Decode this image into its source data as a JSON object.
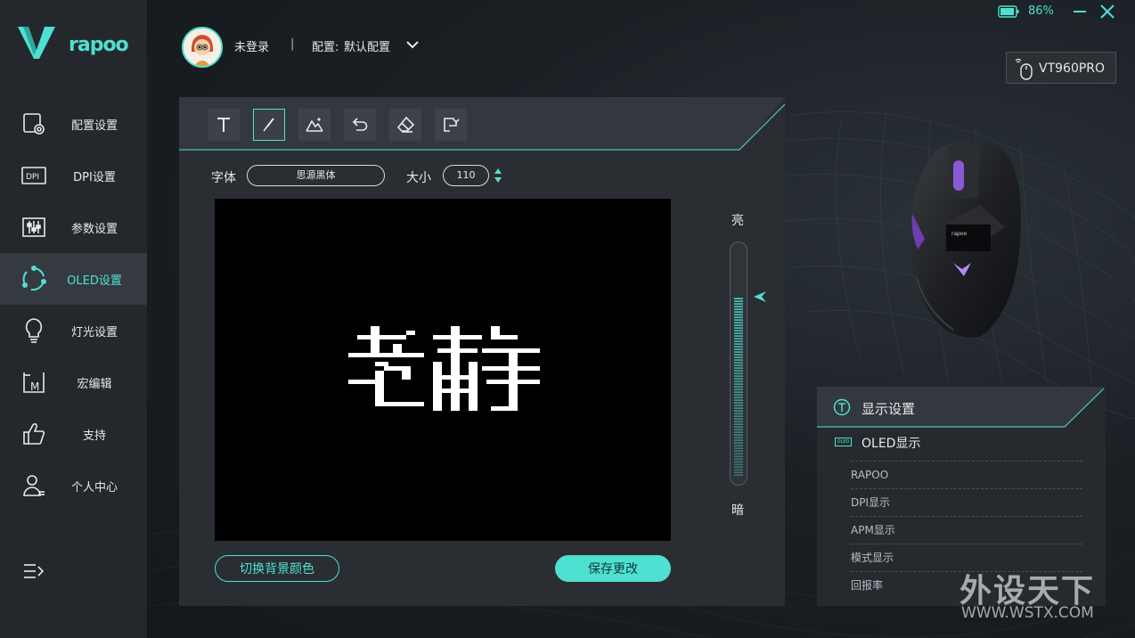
{
  "brand": {
    "logo_text": "rapoo"
  },
  "sidebar": {
    "items": [
      {
        "label": "配置设置",
        "icon": "config-icon"
      },
      {
        "label": "DPI设置",
        "icon": "dpi-icon"
      },
      {
        "label": "参数设置",
        "icon": "params-icon"
      },
      {
        "label": "OLED设置",
        "icon": "oled-icon",
        "active": true
      },
      {
        "label": "灯光设置",
        "icon": "lightbulb-icon"
      },
      {
        "label": "宏编辑",
        "icon": "macro-icon"
      },
      {
        "label": "支持",
        "icon": "thumbs-up-icon"
      },
      {
        "label": "个人中心",
        "icon": "user-icon"
      }
    ],
    "menu_icon": "menu-expand-icon"
  },
  "header": {
    "user_name": "未登录",
    "separator": "|",
    "config_label": "配置:",
    "config_value": "默认配置",
    "battery_pct": "86%",
    "device_name": "VT960PRO"
  },
  "editor": {
    "tools": [
      "text-tool-icon",
      "brush-tool-icon",
      "image-tool-icon",
      "undo-icon",
      "eraser-icon",
      "export-icon"
    ],
    "active_tool": "brush-tool-icon",
    "font_label": "字体",
    "font_value": "思源黑体",
    "size_label": "大小",
    "size_value": "110",
    "canvas_text": "老静",
    "brightness_high": "亮",
    "brightness_low": "暗",
    "brightness_level": 0.78,
    "bg_toggle_label": "切换背景颜色",
    "save_label": "保存更改"
  },
  "display_settings": {
    "title": "显示设置",
    "oled_badge": "OLED",
    "oled_title": "OLED显示",
    "options": [
      "RAPOO",
      "DPI显示",
      "APM显示",
      "模式显示",
      "回报率"
    ]
  },
  "watermark": {
    "title": "外设天下",
    "url": "WWW.WSTX.COM"
  },
  "colors": {
    "accent": "#4ee0d0",
    "sidebar_bg": "#24282d",
    "panel_bg": "#2a2e33"
  }
}
